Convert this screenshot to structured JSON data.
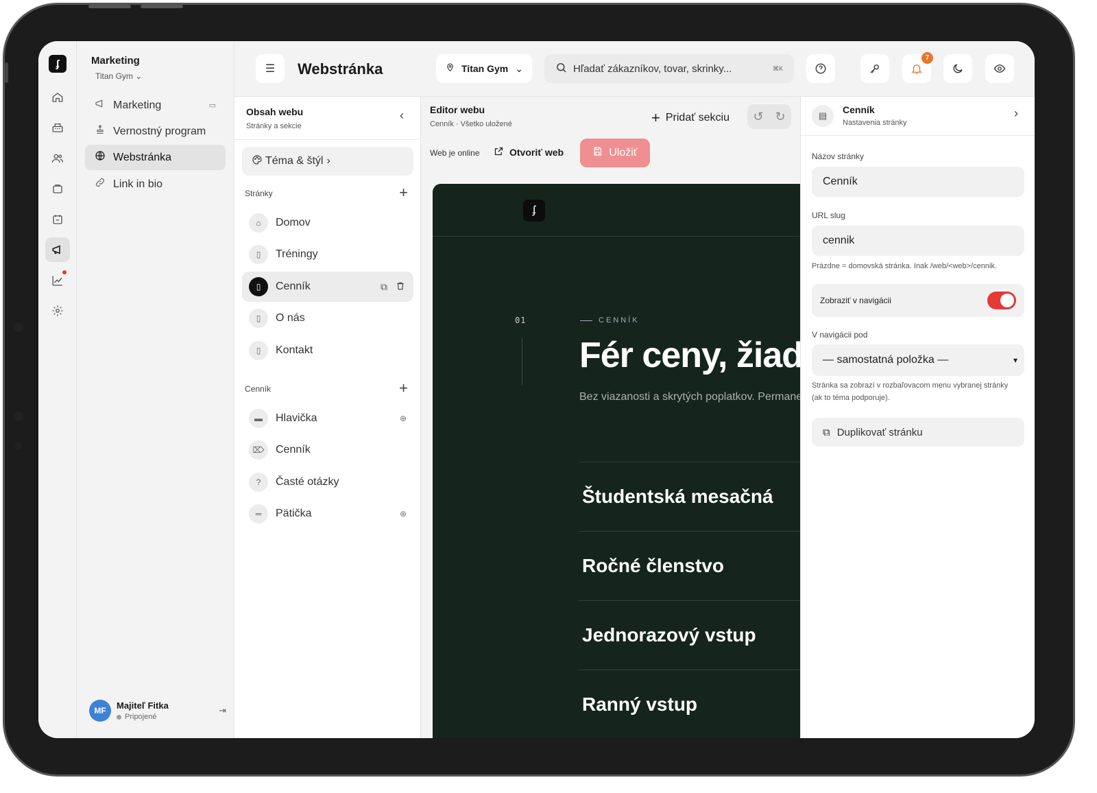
{
  "sidebar": {
    "title": "Marketing",
    "org": "Titan Gym",
    "items": [
      {
        "label": "Marketing"
      },
      {
        "label": "Vernostný program"
      },
      {
        "label": "Webstránka"
      },
      {
        "label": "Link in bio"
      }
    ],
    "user": {
      "initials": "MF",
      "name": "Majiteľ Fitka",
      "status": "Pripojené"
    }
  },
  "topbar": {
    "title": "Webstránka",
    "gym": "Titan Gym",
    "search_placeholder": "Hľadať zákazníkov, tovar, skrinky...",
    "shortcut": "⌘K",
    "notifications": "7"
  },
  "content": {
    "title": "Obsah webu",
    "subtitle": "Stránky a sekcie",
    "theme_label": "Téma & štýl",
    "pages_header": "Stránky",
    "pages": [
      {
        "label": "Domov"
      },
      {
        "label": "Tréningy"
      },
      {
        "label": "Cenník"
      },
      {
        "label": "O nás"
      },
      {
        "label": "Kontakt"
      }
    ],
    "sections_header": "Cenník",
    "sections": [
      {
        "label": "Hlavička"
      },
      {
        "label": "Cenník"
      },
      {
        "label": "Časté otázky"
      },
      {
        "label": "Pätička"
      }
    ]
  },
  "editor": {
    "title": "Editor webu",
    "subtitle": "Cenník · Všetko uložené",
    "add_section": "Pridať sekciu",
    "online": "Web je online",
    "open_web": "Otvoriť web",
    "save": "Uložiť",
    "preview": {
      "number": "01",
      "eyebrow": "CENNÍK",
      "heading": "Fér ceny, žiadne",
      "intro": "Bez viazanosti a skrytých poplatkov. Permanentku môžeš zrušiť kedykoľvek.",
      "plans": [
        "Študentská mesačná",
        "Ročné členstvo",
        "Jednorazový vstup",
        "Ranný vstup"
      ]
    }
  },
  "properties": {
    "title": "Cenník",
    "subtitle": "Nastavenia stránky",
    "name_label": "Názov stránky",
    "name_value": "Cenník",
    "slug_label": "URL slug",
    "slug_value": "cennik",
    "slug_hint": "Prázdne = domovská stránka. Inak /web/<web>/cennik.",
    "nav_toggle_label": "Zobraziť v navigácii",
    "nav_toggle_on": true,
    "nav_parent_label": "V navigácii pod",
    "nav_parent_value": "— samostatná položka —",
    "nav_parent_hint": "Stránka sa zobrazí v rozbaľovacom menu vybranej stránky (ak to téma podporuje).",
    "duplicate": "Duplikovať stránku"
  },
  "colors": {
    "accent": "#e53935",
    "save_button": "#ef8f91",
    "preview_bg": "#15241d",
    "badge": "#e8762a",
    "avatar": "#3b82d8"
  }
}
